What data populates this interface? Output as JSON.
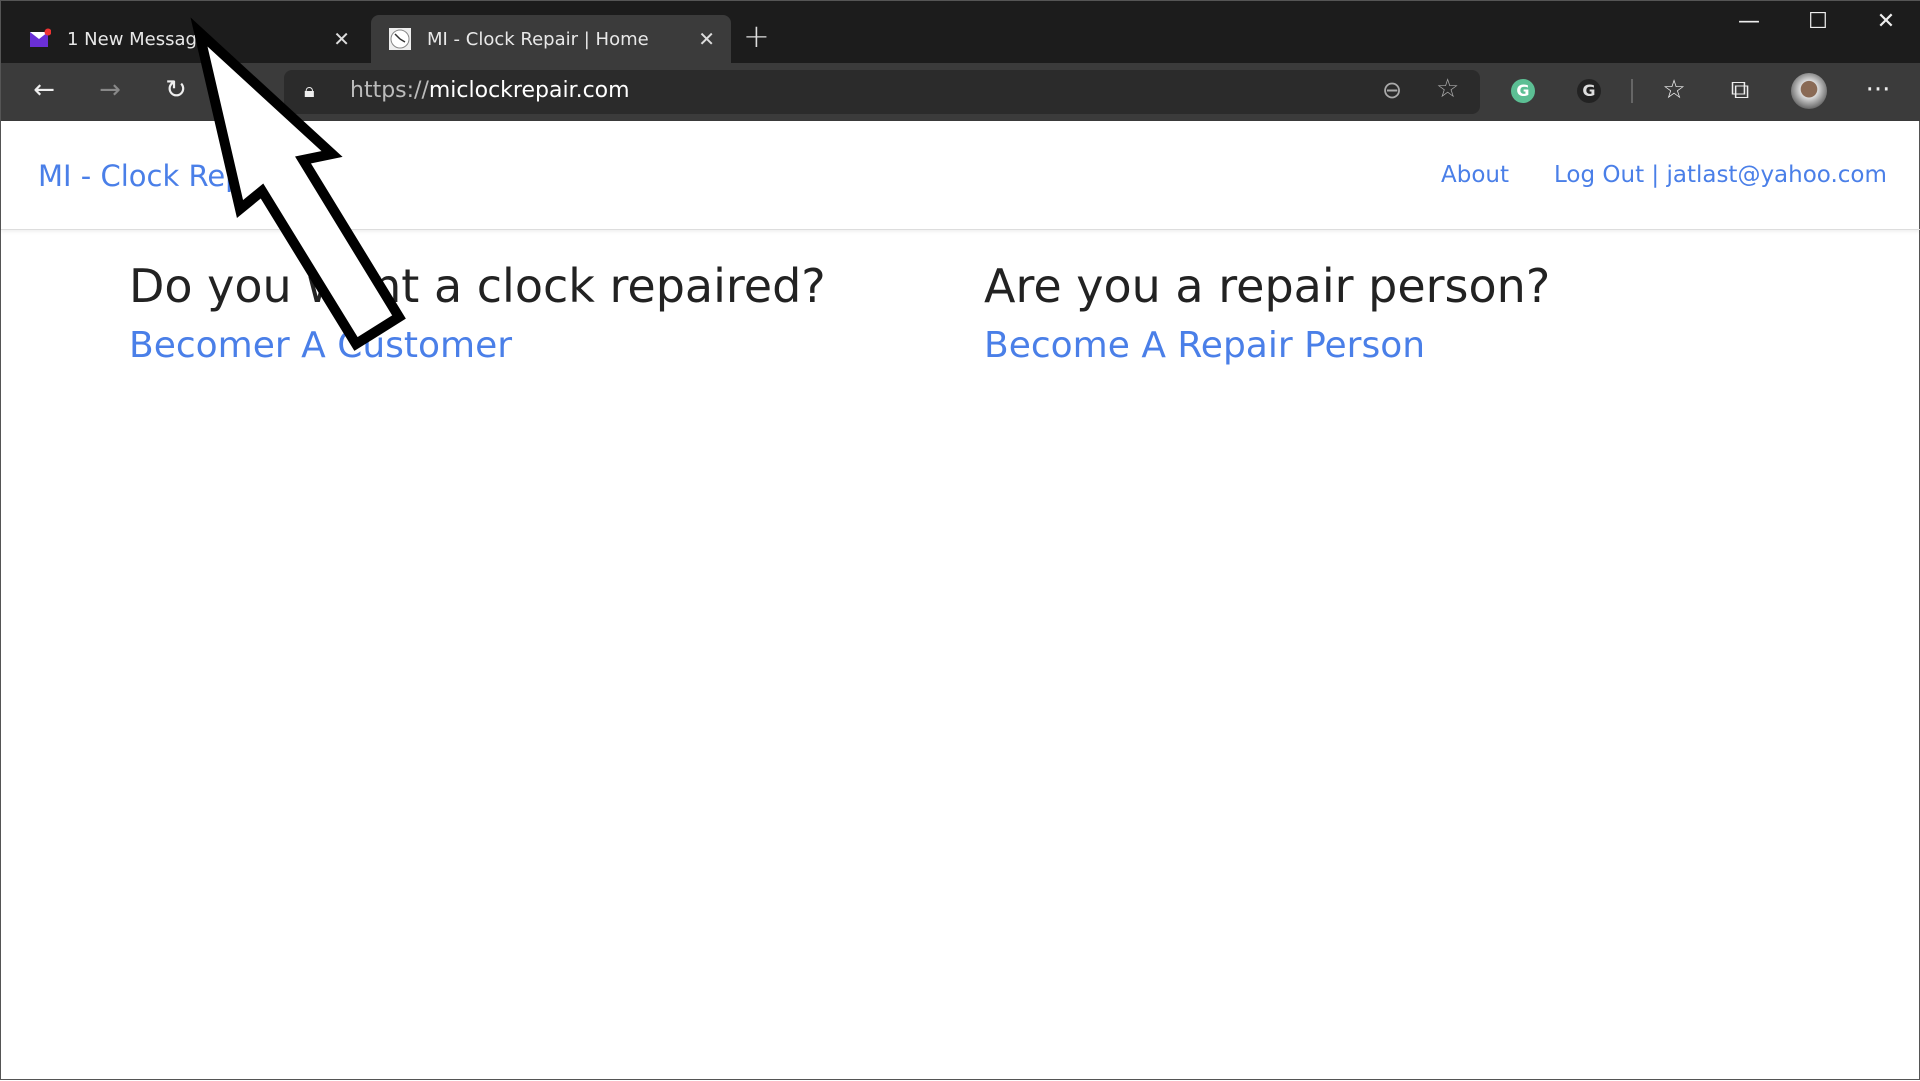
{
  "browser": {
    "tabs": [
      {
        "title": "1 New Message",
        "icon": "mail-icon",
        "active": false
      },
      {
        "title": "MI - Clock Repair | Home",
        "icon": "clock-icon",
        "active": true
      }
    ],
    "url_scheme": "https://",
    "url_host": "miclockrepair.com"
  },
  "site": {
    "brand": "MI - Clock Repair",
    "nav": {
      "about": "About",
      "logout": "Log Out | jatlast@yahoo.com"
    },
    "customer": {
      "heading": "Do you want a clock repaired?",
      "link": "Becomer A Customer"
    },
    "repair": {
      "heading": "Are you a repair person?",
      "link": "Become A Repair Person"
    }
  },
  "colors": {
    "link": "#4a7fe8",
    "grammarly": "#5cbf94"
  }
}
